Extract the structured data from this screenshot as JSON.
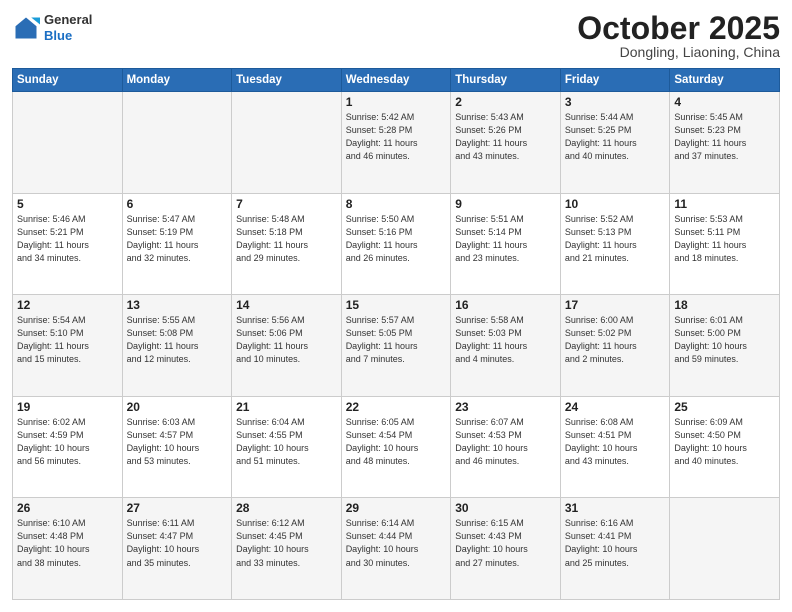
{
  "header": {
    "logo_general": "General",
    "logo_blue": "Blue",
    "month_title": "October 2025",
    "location": "Dongling, Liaoning, China"
  },
  "days_of_week": [
    "Sunday",
    "Monday",
    "Tuesday",
    "Wednesday",
    "Thursday",
    "Friday",
    "Saturday"
  ],
  "weeks": [
    [
      {
        "day": "",
        "info": ""
      },
      {
        "day": "",
        "info": ""
      },
      {
        "day": "",
        "info": ""
      },
      {
        "day": "1",
        "info": "Sunrise: 5:42 AM\nSunset: 5:28 PM\nDaylight: 11 hours\nand 46 minutes."
      },
      {
        "day": "2",
        "info": "Sunrise: 5:43 AM\nSunset: 5:26 PM\nDaylight: 11 hours\nand 43 minutes."
      },
      {
        "day": "3",
        "info": "Sunrise: 5:44 AM\nSunset: 5:25 PM\nDaylight: 11 hours\nand 40 minutes."
      },
      {
        "day": "4",
        "info": "Sunrise: 5:45 AM\nSunset: 5:23 PM\nDaylight: 11 hours\nand 37 minutes."
      }
    ],
    [
      {
        "day": "5",
        "info": "Sunrise: 5:46 AM\nSunset: 5:21 PM\nDaylight: 11 hours\nand 34 minutes."
      },
      {
        "day": "6",
        "info": "Sunrise: 5:47 AM\nSunset: 5:19 PM\nDaylight: 11 hours\nand 32 minutes."
      },
      {
        "day": "7",
        "info": "Sunrise: 5:48 AM\nSunset: 5:18 PM\nDaylight: 11 hours\nand 29 minutes."
      },
      {
        "day": "8",
        "info": "Sunrise: 5:50 AM\nSunset: 5:16 PM\nDaylight: 11 hours\nand 26 minutes."
      },
      {
        "day": "9",
        "info": "Sunrise: 5:51 AM\nSunset: 5:14 PM\nDaylight: 11 hours\nand 23 minutes."
      },
      {
        "day": "10",
        "info": "Sunrise: 5:52 AM\nSunset: 5:13 PM\nDaylight: 11 hours\nand 21 minutes."
      },
      {
        "day": "11",
        "info": "Sunrise: 5:53 AM\nSunset: 5:11 PM\nDaylight: 11 hours\nand 18 minutes."
      }
    ],
    [
      {
        "day": "12",
        "info": "Sunrise: 5:54 AM\nSunset: 5:10 PM\nDaylight: 11 hours\nand 15 minutes."
      },
      {
        "day": "13",
        "info": "Sunrise: 5:55 AM\nSunset: 5:08 PM\nDaylight: 11 hours\nand 12 minutes."
      },
      {
        "day": "14",
        "info": "Sunrise: 5:56 AM\nSunset: 5:06 PM\nDaylight: 11 hours\nand 10 minutes."
      },
      {
        "day": "15",
        "info": "Sunrise: 5:57 AM\nSunset: 5:05 PM\nDaylight: 11 hours\nand 7 minutes."
      },
      {
        "day": "16",
        "info": "Sunrise: 5:58 AM\nSunset: 5:03 PM\nDaylight: 11 hours\nand 4 minutes."
      },
      {
        "day": "17",
        "info": "Sunrise: 6:00 AM\nSunset: 5:02 PM\nDaylight: 11 hours\nand 2 minutes."
      },
      {
        "day": "18",
        "info": "Sunrise: 6:01 AM\nSunset: 5:00 PM\nDaylight: 10 hours\nand 59 minutes."
      }
    ],
    [
      {
        "day": "19",
        "info": "Sunrise: 6:02 AM\nSunset: 4:59 PM\nDaylight: 10 hours\nand 56 minutes."
      },
      {
        "day": "20",
        "info": "Sunrise: 6:03 AM\nSunset: 4:57 PM\nDaylight: 10 hours\nand 53 minutes."
      },
      {
        "day": "21",
        "info": "Sunrise: 6:04 AM\nSunset: 4:55 PM\nDaylight: 10 hours\nand 51 minutes."
      },
      {
        "day": "22",
        "info": "Sunrise: 6:05 AM\nSunset: 4:54 PM\nDaylight: 10 hours\nand 48 minutes."
      },
      {
        "day": "23",
        "info": "Sunrise: 6:07 AM\nSunset: 4:53 PM\nDaylight: 10 hours\nand 46 minutes."
      },
      {
        "day": "24",
        "info": "Sunrise: 6:08 AM\nSunset: 4:51 PM\nDaylight: 10 hours\nand 43 minutes."
      },
      {
        "day": "25",
        "info": "Sunrise: 6:09 AM\nSunset: 4:50 PM\nDaylight: 10 hours\nand 40 minutes."
      }
    ],
    [
      {
        "day": "26",
        "info": "Sunrise: 6:10 AM\nSunset: 4:48 PM\nDaylight: 10 hours\nand 38 minutes."
      },
      {
        "day": "27",
        "info": "Sunrise: 6:11 AM\nSunset: 4:47 PM\nDaylight: 10 hours\nand 35 minutes."
      },
      {
        "day": "28",
        "info": "Sunrise: 6:12 AM\nSunset: 4:45 PM\nDaylight: 10 hours\nand 33 minutes."
      },
      {
        "day": "29",
        "info": "Sunrise: 6:14 AM\nSunset: 4:44 PM\nDaylight: 10 hours\nand 30 minutes."
      },
      {
        "day": "30",
        "info": "Sunrise: 6:15 AM\nSunset: 4:43 PM\nDaylight: 10 hours\nand 27 minutes."
      },
      {
        "day": "31",
        "info": "Sunrise: 6:16 AM\nSunset: 4:41 PM\nDaylight: 10 hours\nand 25 minutes."
      },
      {
        "day": "",
        "info": ""
      }
    ]
  ]
}
